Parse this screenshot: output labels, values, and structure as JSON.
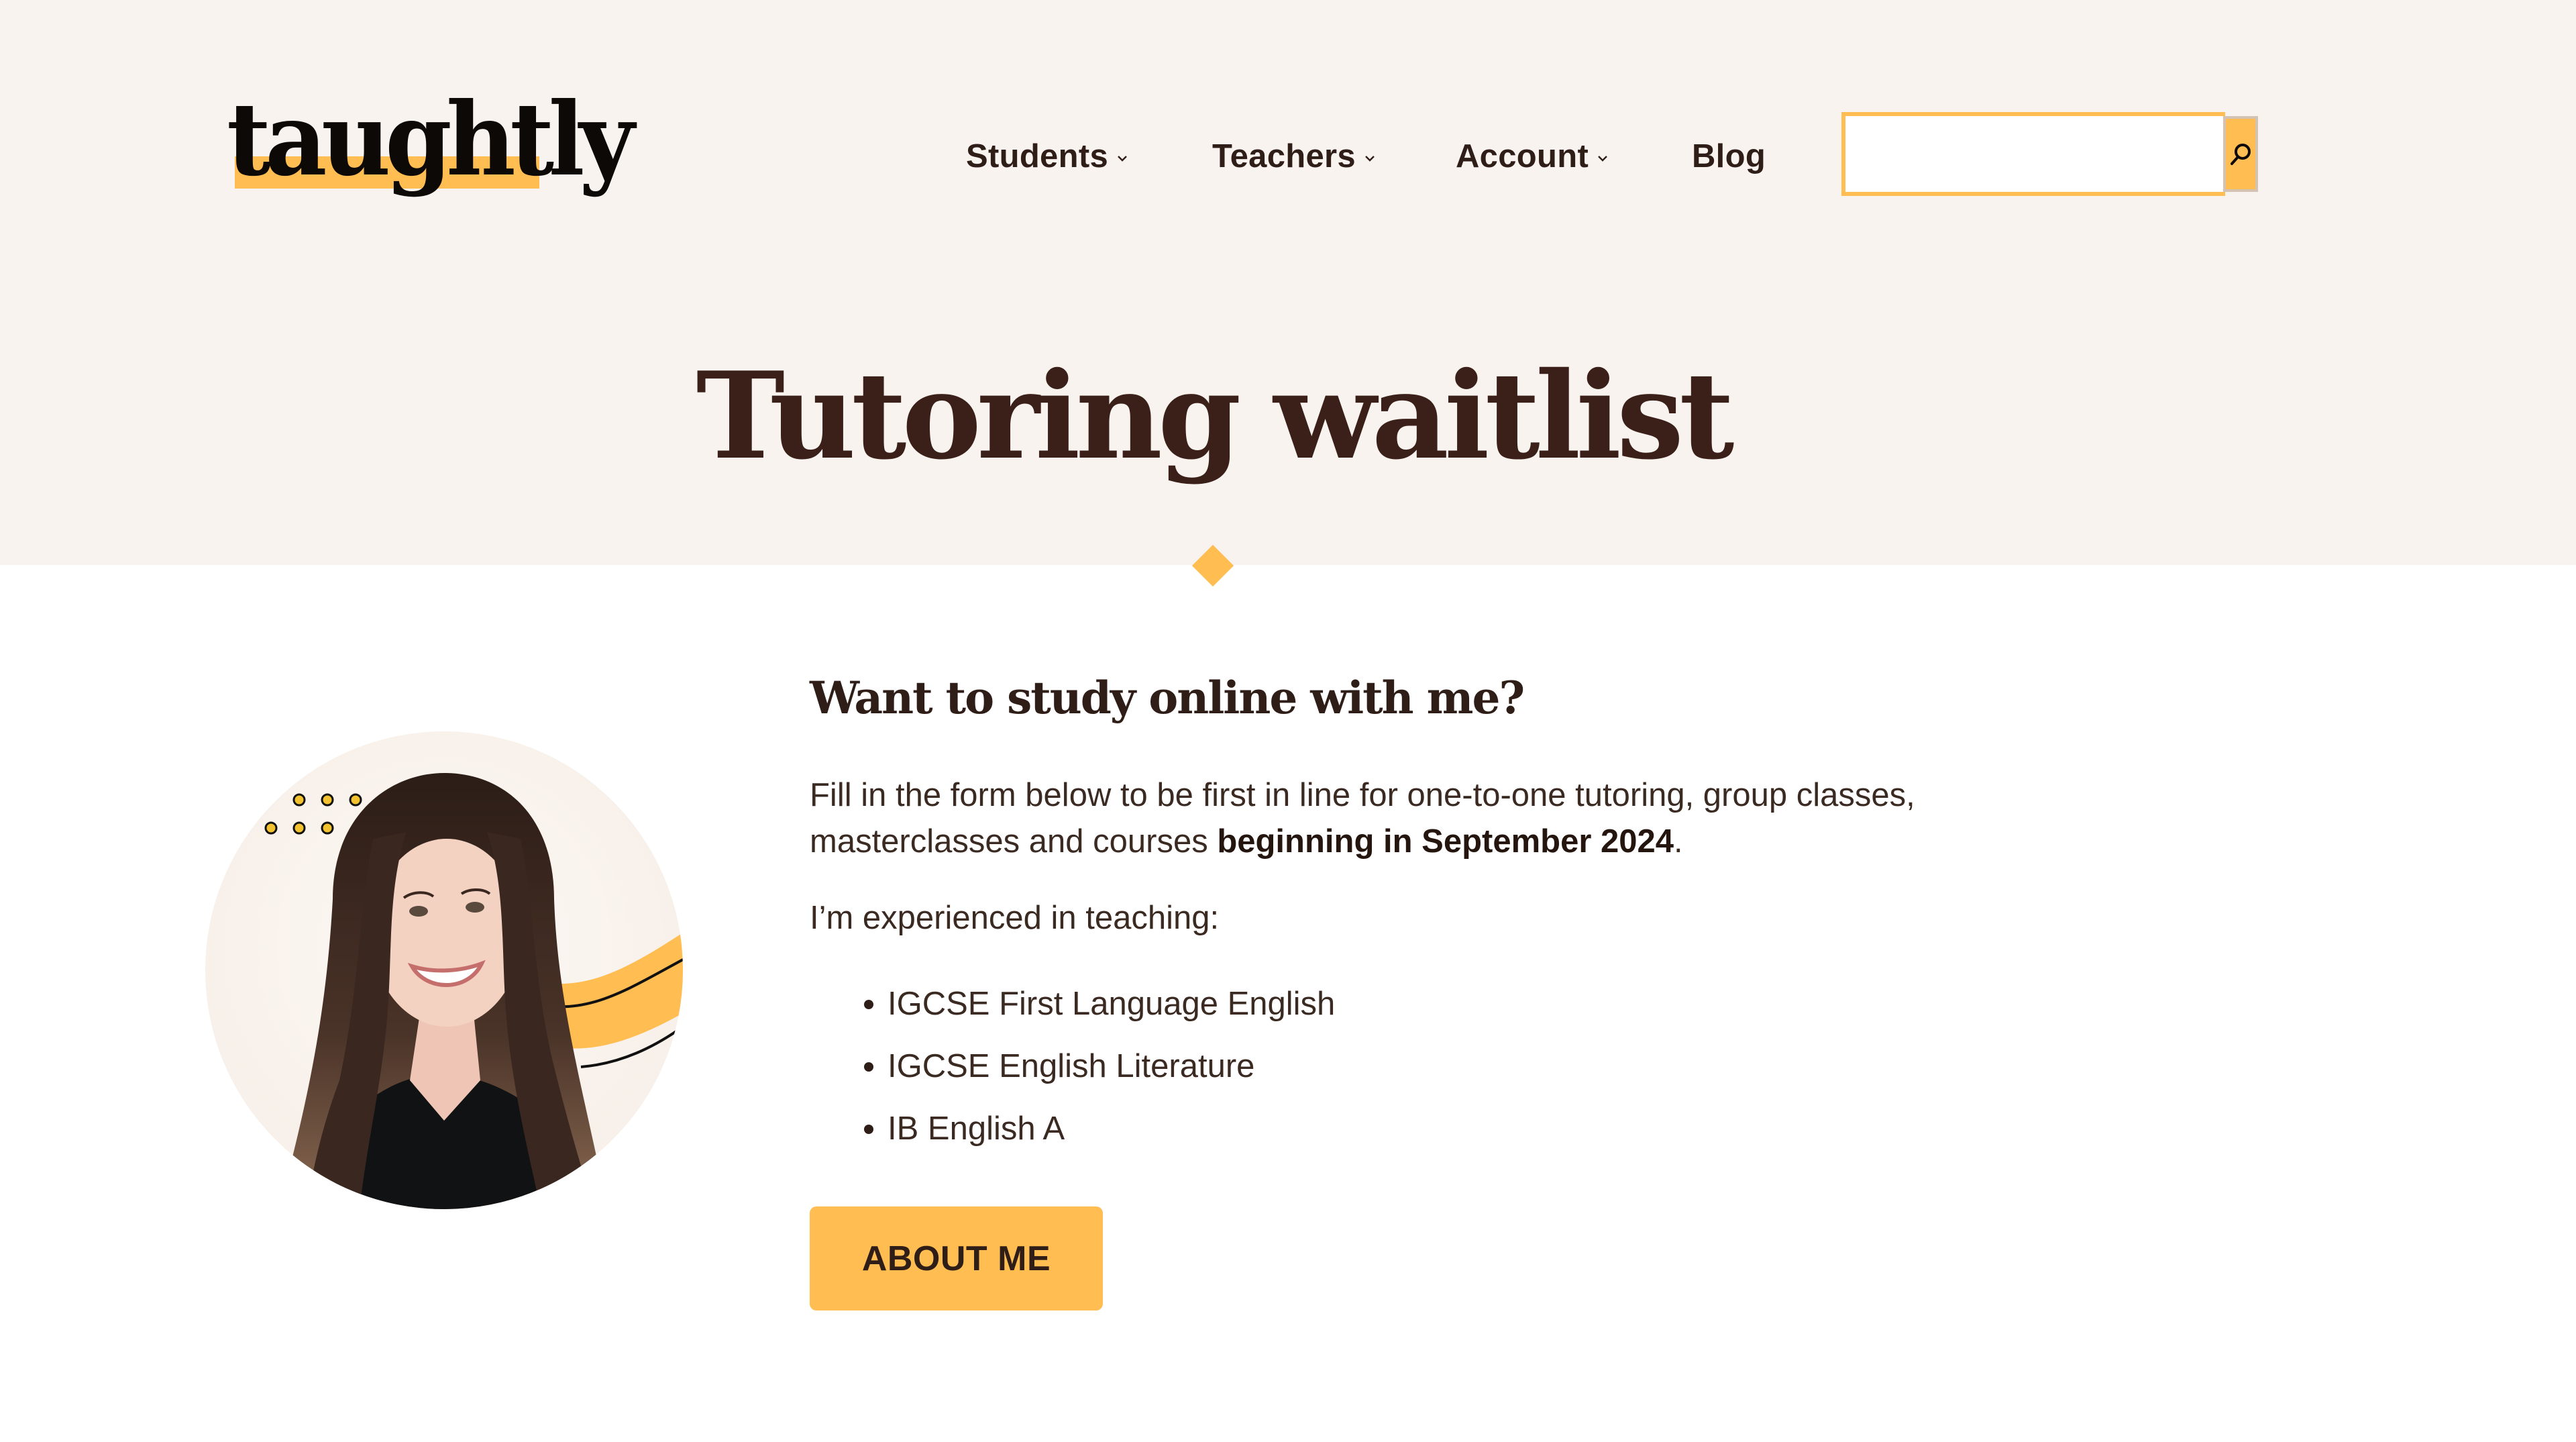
{
  "brand": {
    "logo_text": "taughtly",
    "accent_color": "#ffbd52",
    "text_color": "#2f1e17",
    "hero_bg": "#f9f3ef"
  },
  "nav": {
    "items": [
      {
        "label": "Students",
        "has_dropdown": true,
        "icon": "chevron-down-icon"
      },
      {
        "label": "Teachers",
        "has_dropdown": true,
        "icon": "chevron-down-icon"
      },
      {
        "label": "Account",
        "has_dropdown": true,
        "icon": "chevron-down-icon"
      },
      {
        "label": "Blog",
        "has_dropdown": false
      }
    ]
  },
  "search": {
    "value": "",
    "placeholder": "",
    "button_icon": "search-icon"
  },
  "hero": {
    "title": "Tutoring waitlist"
  },
  "profile": {
    "photo_alt": "Portrait of tutor"
  },
  "main": {
    "heading": "Want to study online with me?",
    "intro_line1": "Fill in the form below to be first in line for one-to-one tutoring, group classes,",
    "intro_line2_prefix": "masterclasses and courses ",
    "intro_line2_bold": "beginning in September 2024",
    "intro_line2_suffix": ".",
    "experience_label": "I’m experienced in teaching:",
    "subjects": [
      "IGCSE First Language English",
      "IGCSE English Literature",
      "IB English A"
    ],
    "cta_label": "ABOUT ME"
  }
}
